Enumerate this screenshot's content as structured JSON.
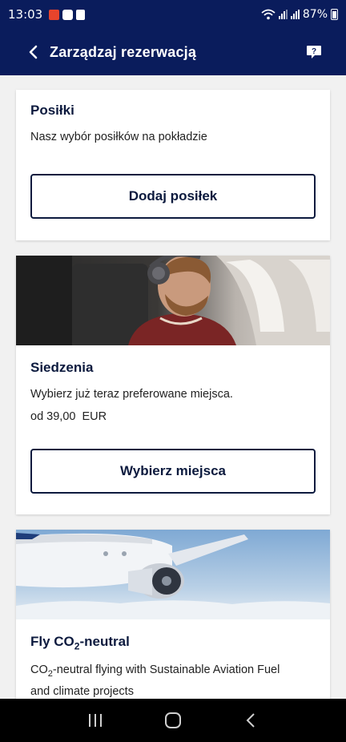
{
  "status_bar": {
    "time": "13:03",
    "battery": "87%"
  },
  "header": {
    "title": "Zarządzaj rezerwacją"
  },
  "cards": [
    {
      "title": "Posiłki",
      "description": "Nasz wybór posiłków na pokładzie",
      "button": "Dodaj posiłek"
    },
    {
      "title": "Siedzenia",
      "description": "Wybierz już teraz preferowane miejsca.",
      "price": "od 39,00  EUR",
      "button": "Wybierz miejsca"
    },
    {
      "title_pre": "Fly CO",
      "title_sub": "2",
      "title_post": "-neutral",
      "desc_pre": "CO",
      "desc_sub": "2",
      "desc_line1": "-neutral flying with Sustainable Aviation Fuel",
      "desc_line2": "and climate projects"
    }
  ],
  "colors": {
    "brand_navy": "#0a1c5c",
    "text_navy": "#0c1a3e"
  }
}
